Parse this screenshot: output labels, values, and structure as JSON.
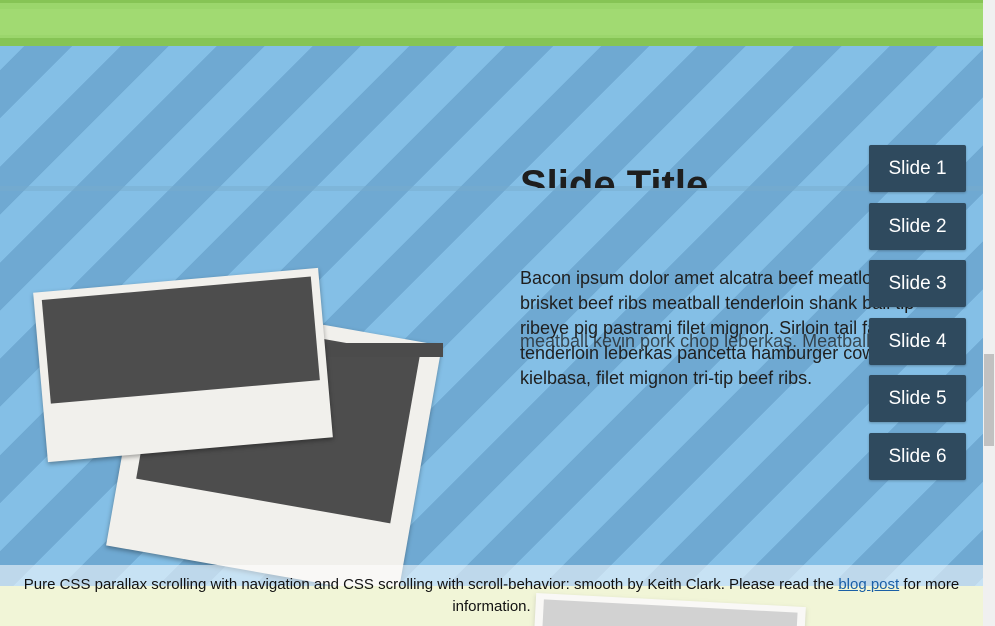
{
  "slide": {
    "title": "Slide Title",
    "body": "Bacon ipsum dolor amet alcatra beef meatloaf, brisket beef ribs meatball tenderloin shank ball tip ribeye pig pastrami filet mignon. Sirloin tail fatback tenderloin leberkas pancetta hamburger cow kielbasa, filet mignon tri-tip beef ribs.",
    "body_overlap": "meatball kevin pork chop leberkas. Meatball"
  },
  "nav": {
    "items": [
      {
        "label": "Slide 1"
      },
      {
        "label": "Slide 2"
      },
      {
        "label": "Slide 3"
      },
      {
        "label": "Slide 4"
      },
      {
        "label": "Slide 5"
      },
      {
        "label": "Slide 6"
      }
    ]
  },
  "footer": {
    "text_before": "Pure CSS parallax scrolling with navigation and CSS scrolling with scroll-behavior: smooth by Keith Clark. Please read the",
    "link_label": "blog post",
    "text_after": "for more",
    "text_line2": "information."
  },
  "colors": {
    "sky": "#7eb8e0",
    "grass": "#9bd66c",
    "nav_button": "#2f4a5e",
    "link": "#1a5fa6"
  }
}
